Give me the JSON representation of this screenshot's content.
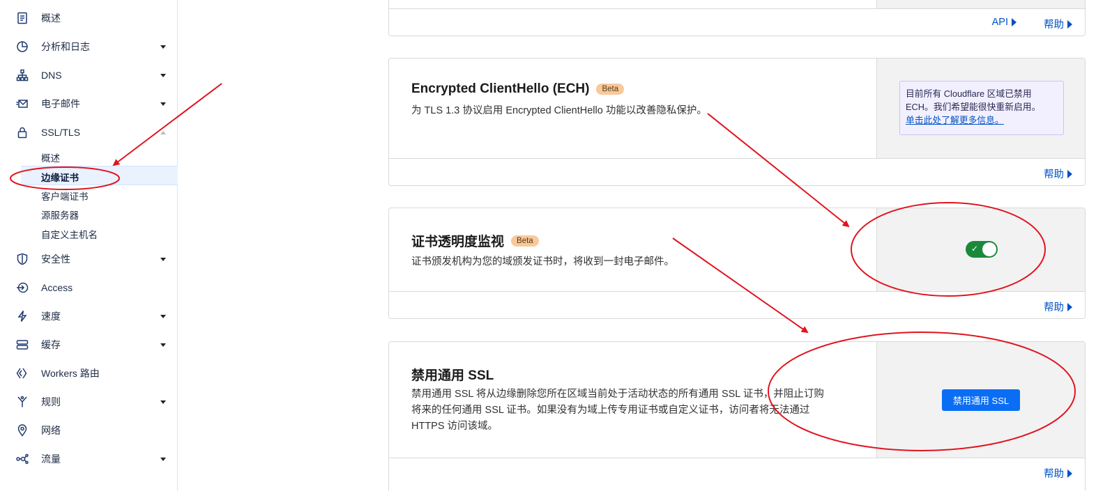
{
  "sidebar": {
    "items": [
      {
        "label": "概述",
        "icon": "document-icon",
        "has_caret": false
      },
      {
        "label": "分析和日志",
        "icon": "pie-chart-icon",
        "has_caret": true
      },
      {
        "label": "DNS",
        "icon": "network-tree-icon",
        "has_caret": true
      },
      {
        "label": "电子邮件",
        "icon": "email-icon",
        "has_caret": true
      },
      {
        "label": "SSL/TLS",
        "icon": "lock-icon",
        "has_caret": true,
        "expanded": true
      },
      {
        "label": "安全性",
        "icon": "shield-icon",
        "has_caret": true
      },
      {
        "label": "Access",
        "icon": "access-icon",
        "has_caret": false
      },
      {
        "label": "速度",
        "icon": "lightning-icon",
        "has_caret": true
      },
      {
        "label": "缓存",
        "icon": "server-stack-icon",
        "has_caret": true
      },
      {
        "label": "Workers 路由",
        "icon": "workers-icon",
        "has_caret": false
      },
      {
        "label": "规则",
        "icon": "rules-icon",
        "has_caret": true
      },
      {
        "label": "网络",
        "icon": "location-pin-icon",
        "has_caret": false
      },
      {
        "label": "流量",
        "icon": "traffic-icon",
        "has_caret": true
      }
    ],
    "ssl_subitems": [
      "概述",
      "边缘证书",
      "客户端证书",
      "源服务器",
      "自定义主机名"
    ],
    "active_subitem": "边缘证书"
  },
  "top_card": {
    "api_link": "API",
    "help_link": "帮助"
  },
  "ech_card": {
    "title": "Encrypted ClientHello (ECH)",
    "badge": "Beta",
    "description": "为 TLS 1.3 协议启用 Encrypted ClientHello 功能以改善隐私保护。",
    "notice_text": "目前所有 Cloudflare 区域已禁用 ECH。我们希望能很快重新启用。",
    "notice_link": "单击此处了解更多信息。",
    "help_link": "帮助"
  },
  "ct_card": {
    "title": "证书透明度监视",
    "badge": "Beta",
    "description": "证书颁发机构为您的域颁发证书时，将收到一封电子邮件。",
    "toggle_on": true,
    "toggle_check": "✓",
    "help_link": "帮助"
  },
  "universal_ssl_card": {
    "title": "禁用通用 SSL",
    "description_lines": [
      "禁用通用 SSL 将从边缘删除您所在区域当前处于活动状态的所有通用 SSL 证书，并阻止订购",
      "将来的任何通用 SSL 证书。如果没有为域上传专用证书或自定义证书，访问者将无法通过",
      "HTTPS 访问该域。"
    ],
    "button": "禁用通用 SSL",
    "help_link": "帮助"
  },
  "colors": {
    "link": "#0051c3",
    "primary_button": "#0a6ef5",
    "toggle_on": "#1a8a3a",
    "beta_badge": "#f8c99b",
    "annotation": "#e0141e"
  }
}
